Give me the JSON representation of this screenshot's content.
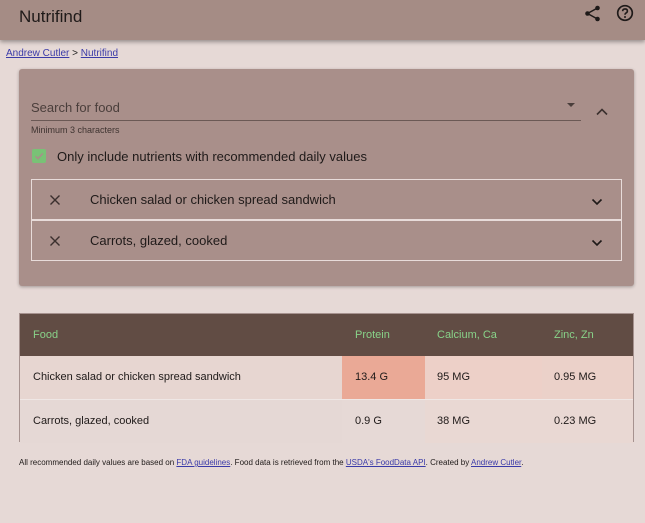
{
  "app": {
    "title": "Nutrifind"
  },
  "breadcrumb": {
    "home": "Andrew Cutler",
    "separator": ">",
    "current": "Nutrifind"
  },
  "search": {
    "placeholder": "Search for food",
    "value": "",
    "hint": "Minimum 3 characters"
  },
  "filter": {
    "label": "Only include nutrients with recommended daily values",
    "checked": true
  },
  "selected_foods": [
    {
      "name": "Chicken salad or chicken spread sandwich"
    },
    {
      "name": "Carrots, glazed, cooked"
    }
  ],
  "table": {
    "headers": [
      "Food",
      "Protein",
      "Calcium, Ca",
      "Zinc, Zn"
    ],
    "rows": [
      [
        "Chicken salad or chicken spread sandwich",
        "13.4 G",
        "95 MG",
        "0.95 MG"
      ],
      [
        "Carrots, glazed, cooked",
        "0.9 G",
        "38 MG",
        "0.23 MG"
      ]
    ]
  },
  "footer": {
    "text1": "All recommended daily values are based on ",
    "link1": "FDA guidelines",
    "text2": ". Food data is retrieved from the ",
    "link2": "USDA's FoodData API",
    "text3": ". Created by ",
    "link3": "Andrew Cutler",
    "text4": "."
  },
  "colors": {
    "appbar": "#a58c85",
    "panel": "#a98f8a",
    "table_header": "#614c44",
    "header_text": "#88d289",
    "checkbox": "#79c276",
    "highlight_strong": "#eaa996",
    "highlight_light": "#edcfc6",
    "highlight_faint": "#ebd8d2"
  },
  "icons": {
    "share": "share-icon",
    "help": "help-circle-icon",
    "remove": "close-icon",
    "expand": "chevron-down-icon",
    "collapse": "chevron-up-icon"
  }
}
